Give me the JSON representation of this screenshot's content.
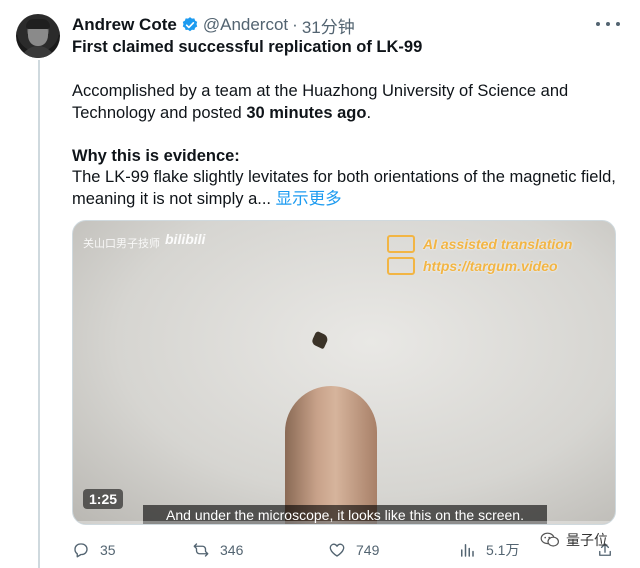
{
  "tweet": {
    "author_name": "Andrew Cote",
    "handle": "@Andercot",
    "separator": "·",
    "time": "31分钟",
    "headline": "First claimed successful replication of LK-99",
    "para1_before": "Accomplished by a team at the Huazhong University of Science and Technology and posted ",
    "para1_bold": "30 minutes ago",
    "para1_after": ".",
    "section_heading": "Why this is evidence:",
    "para2": "The LK-99 flake slightly levitates for both orientations of the magnetic field, meaning it is not simply a...",
    "show_more": "显示更多"
  },
  "video": {
    "watermark_left": "关山口男子技师",
    "watermark_bili": "bilibili",
    "watermark_line1": "AI assisted translation",
    "watermark_line2": "https://targum.video",
    "duration": "1:25",
    "subtitle": "And under the microscope, it looks like this on the screen."
  },
  "actions": {
    "replies": "35",
    "retweets": "346",
    "likes": "749",
    "views": "5.1万"
  },
  "overlay": {
    "wechat_brand": "量子位"
  },
  "colors": {
    "accent": "#1d9bf0",
    "muted": "#536471",
    "watermark": "#f2b544"
  },
  "icons": [
    "verified-badge-icon",
    "more-icon",
    "reply-icon",
    "retweet-icon",
    "like-icon",
    "views-icon",
    "share-icon",
    "wechat-icon"
  ]
}
